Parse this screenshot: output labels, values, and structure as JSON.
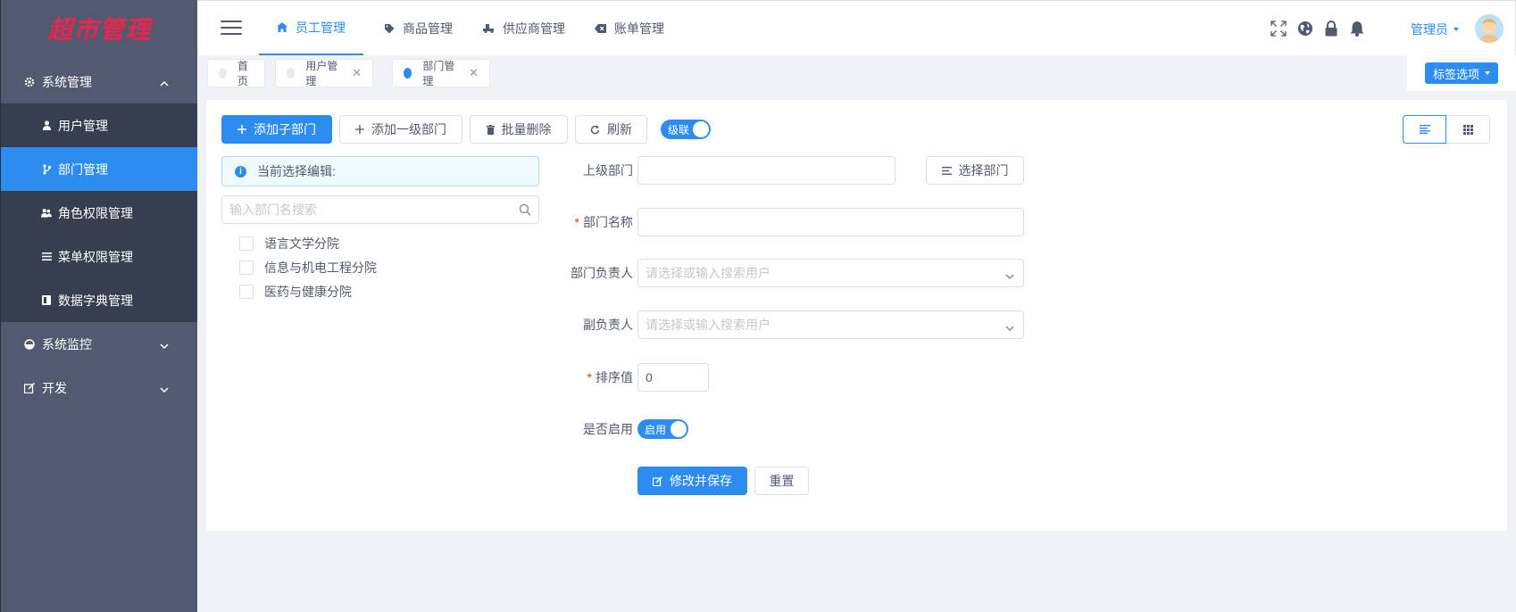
{
  "logo": {
    "text": "超市管理"
  },
  "sidebar": {
    "groups": [
      {
        "label": "系统管理",
        "icon": "gear-icon",
        "expanded": true,
        "items": [
          {
            "label": "用户管理",
            "icon": "user-icon"
          },
          {
            "label": "部门管理",
            "icon": "branch-icon",
            "active": true
          },
          {
            "label": "角色权限管理",
            "icon": "users-icon"
          },
          {
            "label": "菜单权限管理",
            "icon": "list-icon"
          },
          {
            "label": "数据字典管理",
            "icon": "book-icon"
          }
        ]
      },
      {
        "label": "系统监控",
        "icon": "monitor-icon",
        "expanded": false
      },
      {
        "label": "开发",
        "icon": "code-icon",
        "expanded": false
      }
    ]
  },
  "header": {
    "tabs": [
      {
        "label": "员工管理",
        "icon": "home-icon",
        "active": true
      },
      {
        "label": "商品管理",
        "icon": "tag-icon"
      },
      {
        "label": "供应商管理",
        "icon": "truck-icon"
      },
      {
        "label": "账单管理",
        "icon": "bill-icon"
      }
    ],
    "user_label": "管理员"
  },
  "tagbar": {
    "tags": [
      {
        "label": "首页",
        "closable": false
      },
      {
        "label": "用户管理",
        "closable": true
      },
      {
        "label": "部门管理",
        "closable": true,
        "active": true
      }
    ],
    "options_label": "标签选项"
  },
  "toolbar": {
    "add_child_label": "添加子部门",
    "add_top_label": "添加一级部门",
    "batch_delete_label": "批量删除",
    "refresh_label": "刷新",
    "cascade_label": "级联"
  },
  "tree": {
    "alert_label": "当前选择编辑:",
    "search_placeholder": "输入部门名搜索",
    "nodes": [
      {
        "label": "语言文学分院"
      },
      {
        "label": "信息与机电工程分院"
      },
      {
        "label": "医药与健康分院"
      }
    ]
  },
  "form": {
    "parent_label": "上级部门",
    "parent_value": "",
    "select_dept_label": "选择部门",
    "name_label": "部门名称",
    "name_value": "",
    "leader_label": "部门负责人",
    "leader_placeholder": "请选择或输入搜索用户",
    "deputy_label": "副负责人",
    "deputy_placeholder": "请选择或输入搜索用户",
    "sort_label": "排序值",
    "sort_value": "0",
    "enabled_label": "是否启用",
    "enabled_switch_label": "启用",
    "save_label": "修改并保存",
    "reset_label": "重置"
  },
  "colors": {
    "primary": "#2d8cf0",
    "sidebar_bg": "#515a6e",
    "submenu_bg": "#363e4f",
    "required": "#ed4014",
    "logo": "#e8254f"
  }
}
